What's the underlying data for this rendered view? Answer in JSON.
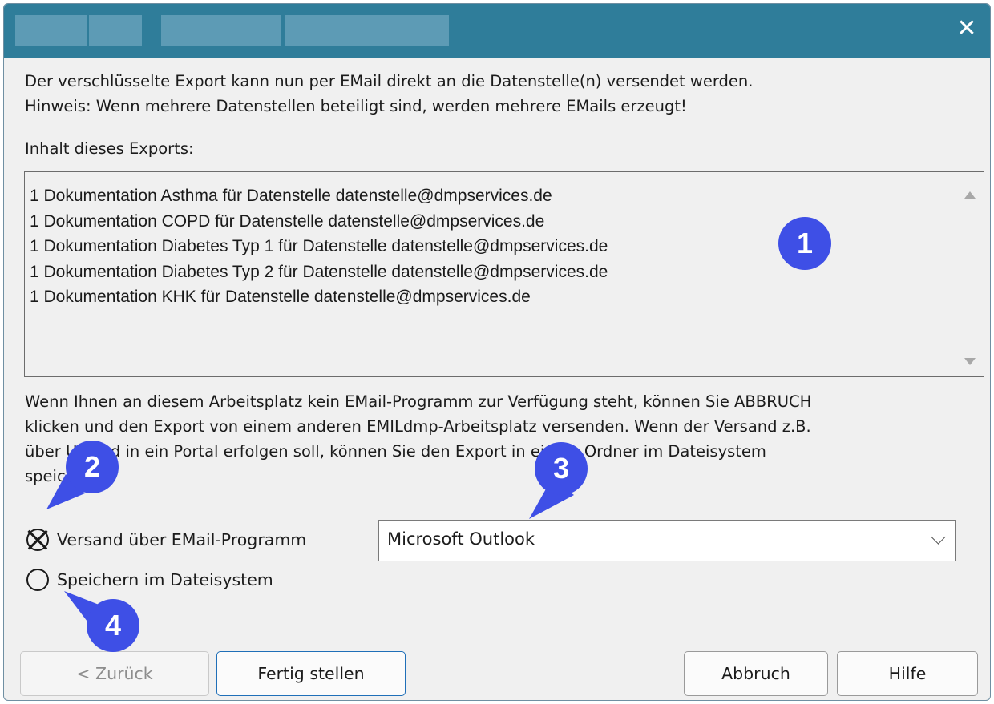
{
  "window": {
    "close_glyph": "✕"
  },
  "intro": {
    "line1": "Der verschlüsselte Export kann nun per EMail direkt an die Datenstelle(n) versendet werden.",
    "line2": "Hinweis: Wenn mehrere Datenstellen beteiligt sind, werden mehrere EMails erzeugt!"
  },
  "contents_label": "Inhalt dieses Exports:",
  "export_list": [
    "1 Dokumentation Asthma für Datenstelle datenstelle@dmpservices.de",
    "1 Dokumentation COPD für Datenstelle datenstelle@dmpservices.de",
    "1 Dokumentation Diabetes Typ 1 für Datenstelle datenstelle@dmpservices.de",
    "1 Dokumentation Diabetes Typ 2 für Datenstelle datenstelle@dmpservices.de",
    "1 Dokumentation KHK für Datenstelle datenstelle@dmpservices.de"
  ],
  "info": {
    "line1": "Wenn Ihnen an diesem Arbeitsplatz kein EMail-Programm zur Verfügung steht, können Sie ABBRUCH",
    "line2": "klicken und den Export von einem anderen EMILdmp-Arbeitsplatz versenden. Wenn der Versand z.B.",
    "line3": "über Upload in ein Portal erfolgen soll, können Sie den Export in einem Ordner im Dateisystem",
    "line4": "speichern."
  },
  "options": {
    "email": {
      "label": "Versand über EMail-Programm",
      "checked": true
    },
    "filesystem": {
      "label": "Speichern im Dateisystem",
      "checked": false
    }
  },
  "email_program": {
    "selected": "Microsoft Outlook"
  },
  "buttons": {
    "back": "< Zurück",
    "finish": "Fertig stellen",
    "cancel": "Abbruch",
    "help": "Hilfe"
  },
  "callouts": [
    "1",
    "2",
    "3",
    "4"
  ],
  "colors": {
    "titlebar": "#2f7d9a",
    "callout": "#3e4fe6",
    "default_button_border": "#1f6fb8"
  }
}
